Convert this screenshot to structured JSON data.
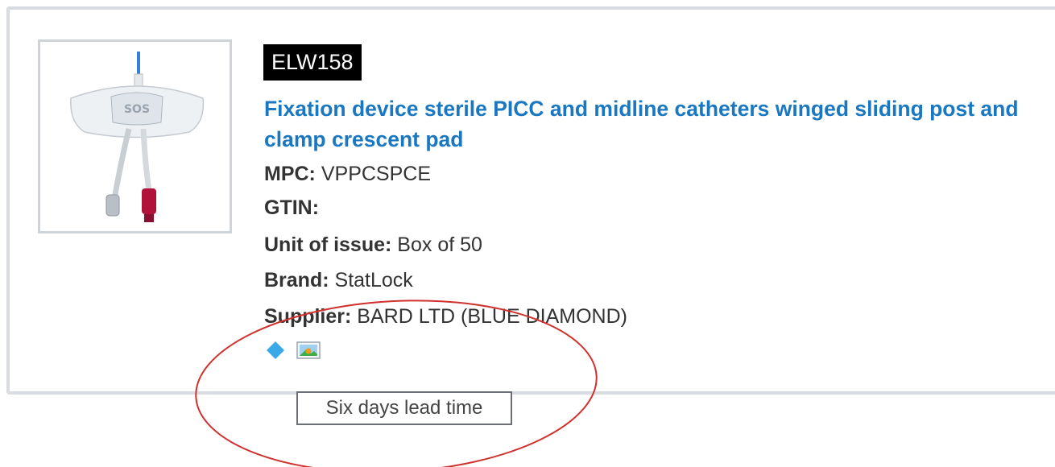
{
  "product": {
    "code": "ELW158",
    "title": "Fixation device sterile PICC and midline catheters winged sliding post and clamp crescent pad",
    "fields": [
      {
        "label": "MPC:",
        "value": "VPPCSPCE"
      },
      {
        "label": "GTIN:",
        "value": ""
      },
      {
        "label": "Unit of issue:",
        "value": "Box of 50"
      },
      {
        "label": "Brand:",
        "value": "StatLock"
      },
      {
        "label": "Supplier:",
        "value": "BARD LTD (BLUE DIAMOND)"
      }
    ],
    "icons": [
      "blue-diamond-icon",
      "image-icon"
    ]
  },
  "tooltip": {
    "text": "Six days lead time"
  },
  "colors": {
    "title": "#1a78c2",
    "badge_bg": "#000000",
    "diamond": "#3aa9e8",
    "annotation": "#d0312d",
    "card_border": "#d8dce0"
  }
}
